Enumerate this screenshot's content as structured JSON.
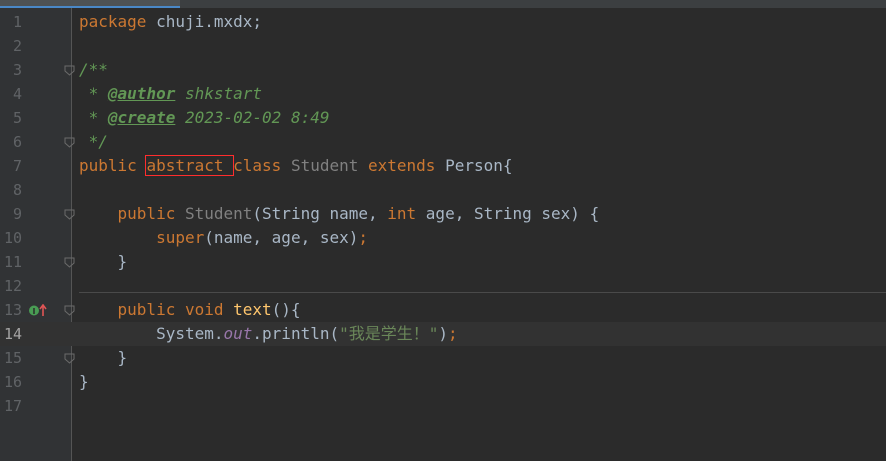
{
  "editor": {
    "lines": [
      {
        "n": "1",
        "tokens": [
          {
            "t": "package ",
            "c": "kw"
          },
          {
            "t": "chuji.mxdx;",
            "c": "plain"
          }
        ]
      },
      {
        "n": "2",
        "tokens": []
      },
      {
        "n": "3",
        "tokens": [
          {
            "t": "/**",
            "c": "comment"
          }
        ]
      },
      {
        "n": "4",
        "tokens": [
          {
            "t": " * ",
            "c": "comment"
          },
          {
            "t": "@author",
            "c": "tag"
          },
          {
            "t": " shkstart",
            "c": "comment"
          }
        ]
      },
      {
        "n": "5",
        "tokens": [
          {
            "t": " * ",
            "c": "comment"
          },
          {
            "t": "@create",
            "c": "tag"
          },
          {
            "t": " 2023-02-02 8:49",
            "c": "comment"
          }
        ]
      },
      {
        "n": "6",
        "tokens": [
          {
            "t": " */",
            "c": "comment"
          }
        ]
      },
      {
        "n": "7",
        "tokens": [
          {
            "t": "public ",
            "c": "kw"
          },
          {
            "t": "abstract ",
            "c": "kw",
            "box": true
          },
          {
            "t": "class ",
            "c": "kw"
          },
          {
            "t": "Student ",
            "c": "unused"
          },
          {
            "t": "extends ",
            "c": "kw"
          },
          {
            "t": "Person{",
            "c": "plain"
          }
        ]
      },
      {
        "n": "8",
        "tokens": []
      },
      {
        "n": "9",
        "tokens": [
          {
            "t": "    public ",
            "c": "kw"
          },
          {
            "t": "Student",
            "c": "unused"
          },
          {
            "t": "(String name, ",
            "c": "plain"
          },
          {
            "t": "int ",
            "c": "kw"
          },
          {
            "t": "age, ",
            "c": "plain"
          },
          {
            "t": "String sex) {",
            "c": "plain"
          }
        ]
      },
      {
        "n": "10",
        "tokens": [
          {
            "t": "        super",
            "c": "kw"
          },
          {
            "t": "(name, ",
            "c": "plain"
          },
          {
            "t": "age, ",
            "c": "plain"
          },
          {
            "t": "sex)",
            "c": "plain"
          },
          {
            "t": ";",
            "c": "kw"
          }
        ]
      },
      {
        "n": "11",
        "tokens": [
          {
            "t": "    }",
            "c": "plain"
          }
        ]
      },
      {
        "n": "12",
        "tokens": []
      },
      {
        "n": "13",
        "tokens": [
          {
            "t": "    public void ",
            "c": "kw"
          },
          {
            "t": "text",
            "c": "fn"
          },
          {
            "t": "(){",
            "c": "plain"
          }
        ]
      },
      {
        "n": "14",
        "tokens": [
          {
            "t": "        System.",
            "c": "plain"
          },
          {
            "t": "out",
            "c": "static"
          },
          {
            "t": ".println(",
            "c": "plain"
          },
          {
            "t": "\"我是学生！\"",
            "c": "str"
          },
          {
            "t": ")",
            "c": "plain"
          },
          {
            "t": ";",
            "c": "kw"
          }
        ]
      },
      {
        "n": "15",
        "tokens": [
          {
            "t": "    }",
            "c": "plain"
          }
        ]
      },
      {
        "n": "16",
        "tokens": [
          {
            "t": "}",
            "c": "plain"
          }
        ]
      },
      {
        "n": "17",
        "tokens": []
      }
    ],
    "current_line": "14",
    "fold_markers": [
      "3",
      "6",
      "9",
      "11",
      "13",
      "15"
    ],
    "gutter_icons": [
      {
        "line": "13",
        "icon": "implements-overrides-icon"
      }
    ],
    "colors": {
      "background": "#2b2b2b",
      "keyword": "#cc7832",
      "comment": "#629755",
      "string": "#6a8759",
      "function": "#ffc66d",
      "static_field": "#9876aa",
      "highlight_box": "#ff2d2d"
    }
  }
}
